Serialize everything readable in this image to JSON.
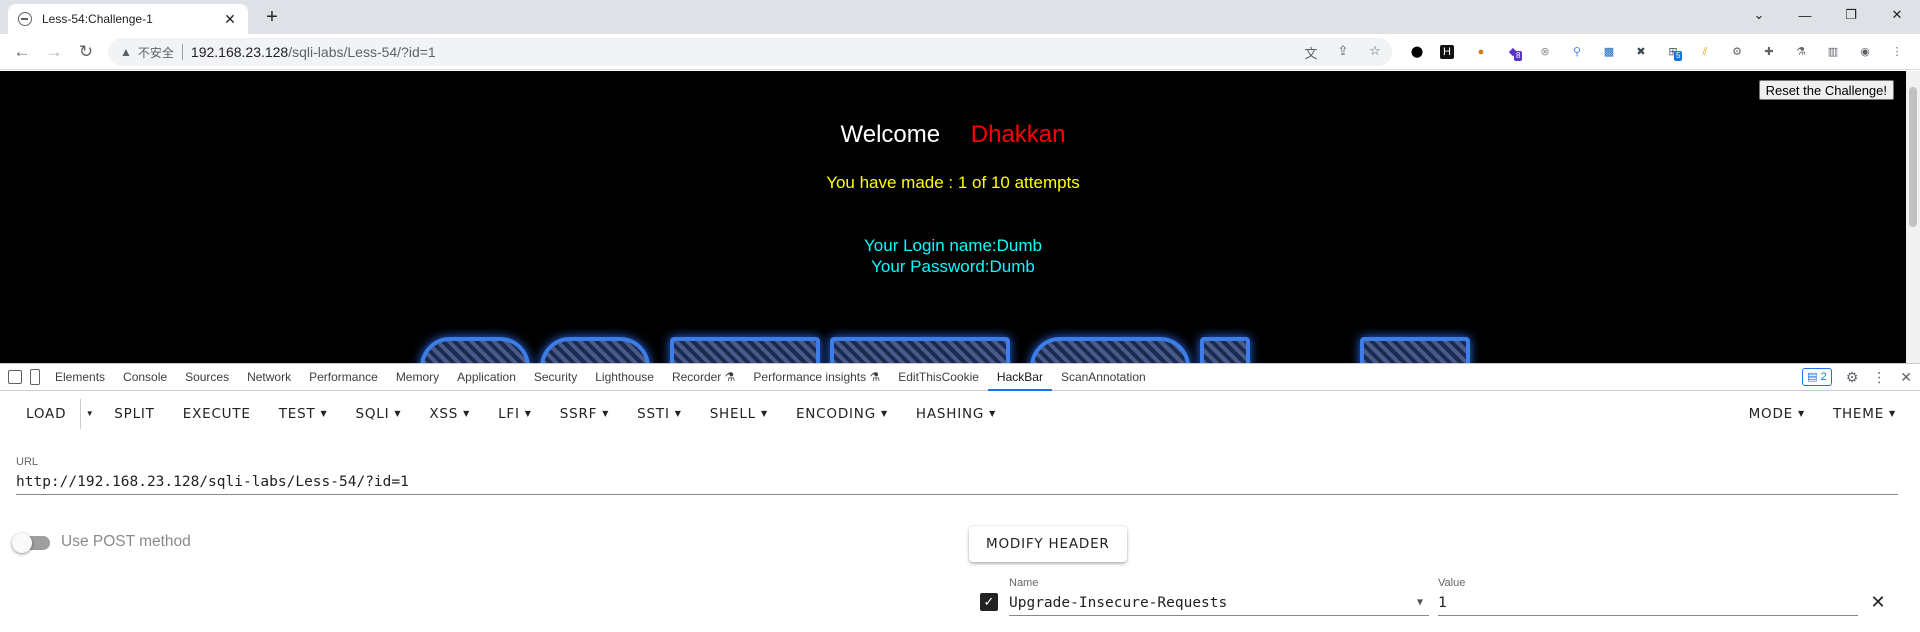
{
  "browser": {
    "tab_title": "Less-54:Challenge-1",
    "tab_close": "✕",
    "new_tab": "+",
    "security_label": "不安全",
    "url_host": "192.168.23.128",
    "url_path": "/sqli-labs/Less-54/?id=1",
    "ext_badge_count_1": "8",
    "ext_badge_count_2": "5"
  },
  "page": {
    "reset_button": "Reset the Challenge!",
    "welcome": "Welcome",
    "username": "Dhakkan",
    "attempts": "You have made : 1 of 10 attempts",
    "login_name": "Your Login name:Dumb",
    "password": "Your Password:Dumb",
    "colors": {
      "background": "#000000",
      "welcome": "#ffffff",
      "username": "#ff0000",
      "attempts": "#ffff00",
      "login": "#00ffff"
    }
  },
  "devtools": {
    "tabs": [
      "Elements",
      "Console",
      "Sources",
      "Network",
      "Performance",
      "Memory",
      "Application",
      "Security",
      "Lighthouse",
      "Recorder ⚗",
      "Performance insights ⚗",
      "EditThisCookie",
      "HackBar",
      "ScanAnnotation"
    ],
    "active_tab": "HackBar",
    "issues_count": "2"
  },
  "hackbar": {
    "menu": {
      "load": "LOAD",
      "split": "SPLIT",
      "execute": "EXECUTE",
      "test": "TEST",
      "sqli": "SQLI",
      "xss": "XSS",
      "lfi": "LFI",
      "ssrf": "SSRF",
      "ssti": "SSTI",
      "shell": "SHELL",
      "encoding": "ENCODING",
      "hashing": "HASHING",
      "mode": "MODE",
      "theme": "THEME"
    },
    "url_label": "URL",
    "url_value": "http://192.168.23.128/sqli-labs/Less-54/?id=1",
    "post_label": "Use POST method",
    "post_enabled": false,
    "modify_header": "MODIFY HEADER",
    "header": {
      "enabled": true,
      "name_label": "Name",
      "name_value": "Upgrade-Insecure-Requests",
      "value_label": "Value",
      "value_value": "1"
    }
  }
}
